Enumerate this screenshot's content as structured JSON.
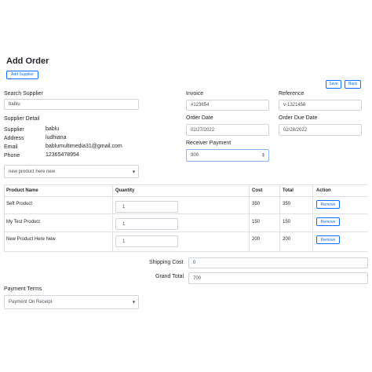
{
  "page": {
    "title": "Add Order",
    "add_supplier_label": "Add Supplier",
    "save_label": "Save",
    "back_label": "Back"
  },
  "supplier": {
    "search_label": "Search Supplier",
    "search_value": "bablu",
    "detail_heading": "Supplier Detail",
    "supplier_key": "Supplier",
    "supplier_value": "bablu",
    "address_key": "Address",
    "address_value": "ludhiana",
    "email_key": "Email",
    "email_value": "bablumultimedia31@gmail.com",
    "phone_key": "Phone",
    "phone_value": "12365478954"
  },
  "invoice": {
    "label": "Invoice",
    "value": "#123654"
  },
  "reference": {
    "label": "Reference",
    "value": "v-1321456"
  },
  "order_date": {
    "label": "Order Date",
    "value": "02/27/2022"
  },
  "order_due_date": {
    "label": "Order Due Date",
    "value": "02/28/2022"
  },
  "receiver_payment": {
    "label": "Receiver Payment",
    "value": "300"
  },
  "product_select": {
    "value": "new product here new"
  },
  "table": {
    "headers": [
      "Product Name",
      "Quantity",
      "Cost",
      "Total",
      "Action"
    ],
    "rows": [
      {
        "name": "Seft Product",
        "qty": "1",
        "cost": "350",
        "total": "350",
        "action": "Remove"
      },
      {
        "name": "My Test Product",
        "qty": "1",
        "cost": "150",
        "total": "150",
        "action": "Remove"
      },
      {
        "name": "New Product Here New",
        "qty": "1",
        "cost": "200",
        "total": "200",
        "action": "Remove"
      }
    ]
  },
  "totals": {
    "shipping_label": "Shipping Cost",
    "shipping_value": "0",
    "grand_label": "Grand Total",
    "grand_value": "700"
  },
  "payment_terms": {
    "label": "Payment Terms",
    "value": "Payment On Receipt"
  },
  "colors": {
    "accent": "#0d6efd",
    "border": "#ced4da",
    "focus": "#86b7fe"
  }
}
